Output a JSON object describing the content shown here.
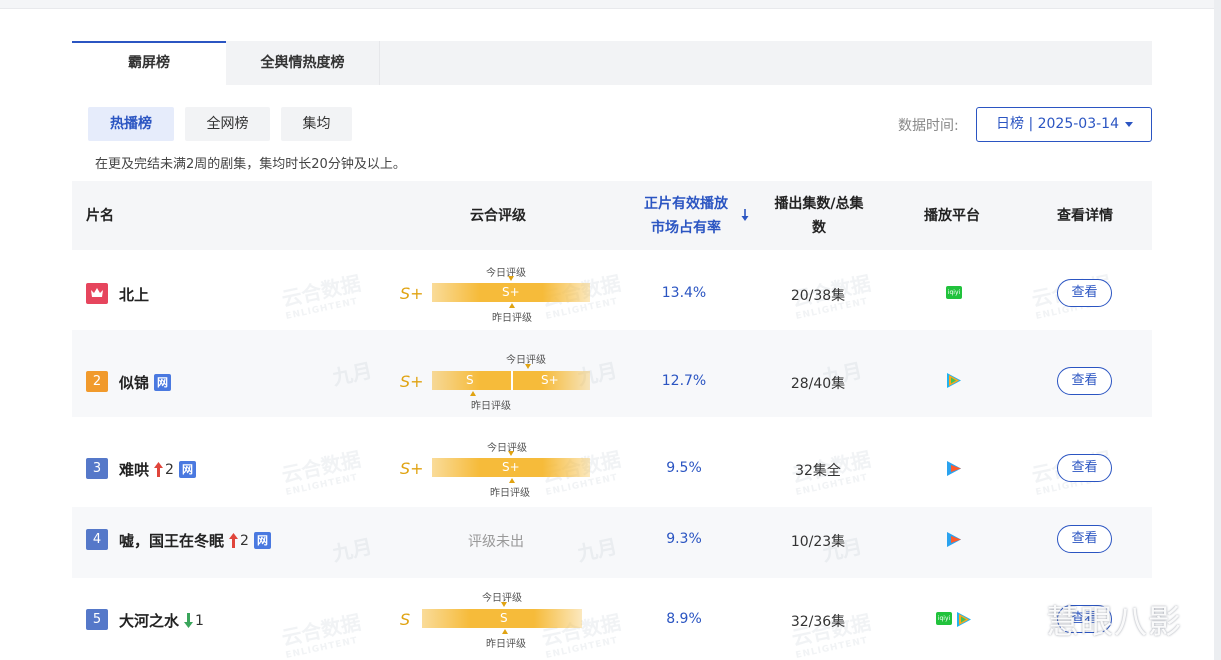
{
  "main_tabs": [
    "霸屏榜",
    "全舆情热度榜"
  ],
  "sub_tabs": [
    "热播榜",
    "全网榜",
    "集均"
  ],
  "note": "在更及完结未满2周的剧集，集均时长20分钟及以上。",
  "data_time": {
    "label": "数据时间:",
    "value": "日榜 | 2025-03-14"
  },
  "columns": [
    "片名",
    "云合评级",
    "正片有效播放",
    "市场占有率",
    "播出集数/总集",
    "数",
    "播放平台",
    "查看详情"
  ],
  "labels": {
    "today": "今日评级",
    "yesterday": "昨日评级",
    "net": "网",
    "view": "查看",
    "iqiyi": "iqiyi"
  },
  "watermarks": {
    "brand_cn": "云合数据",
    "brand_en": "ENLIGHTENT",
    "jiuyue": "九月"
  },
  "rows": [
    {
      "rank": "",
      "title": "北上",
      "grade": "S+",
      "bar_today": "S+",
      "share": "13.4%",
      "episodes": "20/38集",
      "platforms": [
        "iqiyi"
      ]
    },
    {
      "rank": "2",
      "title": "似锦",
      "grade": "S+",
      "bar_yesterday": "S",
      "bar_today": "S+",
      "share": "12.7%",
      "episodes": "28/40集",
      "platforms": [
        "tencent"
      ]
    },
    {
      "rank": "3",
      "title": "难哄",
      "trend": "2",
      "grade": "S+",
      "bar_today": "S+",
      "share": "9.5%",
      "episodes": "32集全",
      "platforms": [
        "youku"
      ]
    },
    {
      "rank": "4",
      "title": "嘘，国王在冬眠",
      "trend": "2",
      "pending": "评级未出",
      "share": "9.3%",
      "episodes": "10/23集",
      "platforms": [
        "youku"
      ]
    },
    {
      "rank": "5",
      "title": "大河之水",
      "trend": "1",
      "grade": "S",
      "bar_today": "S",
      "share": "8.9%",
      "episodes": "32/36集",
      "platforms": [
        "iqiyi",
        "tencent"
      ]
    }
  ],
  "colors": {
    "accent": "#2b55c2",
    "gold": "#e0a312",
    "rank1": "#e6455d",
    "rank2": "#f19a2c",
    "rank_other": "#5578c9",
    "up": "#e0453b",
    "down": "#3aa55b"
  },
  "corner_watermark": "慧眼八影"
}
